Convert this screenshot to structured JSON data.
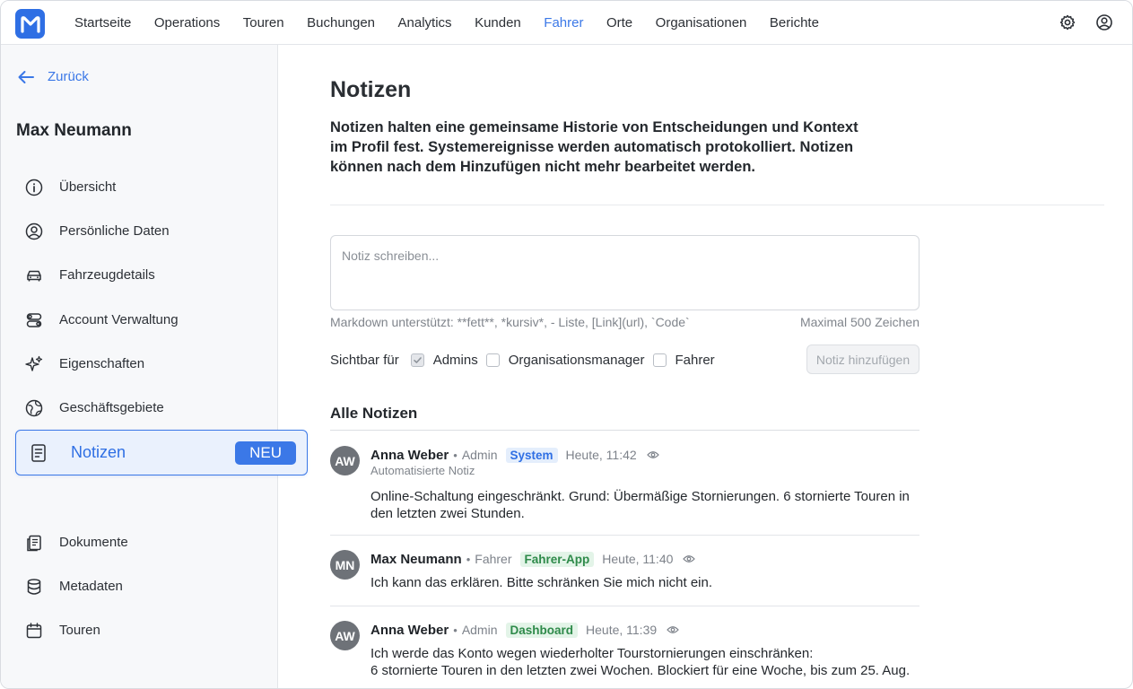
{
  "nav": {
    "items": [
      "Startseite",
      "Operations",
      "Touren",
      "Buchungen",
      "Analytics",
      "Kunden",
      "Fahrer",
      "Orte",
      "Organisationen",
      "Berichte"
    ],
    "active": "Fahrer",
    "icons": [
      "settings-gear-icon",
      "user-account-icon"
    ]
  },
  "sidebar": {
    "back_label": "Zurück",
    "driver_name": "Max Neumann",
    "items": [
      {
        "label": "Übersicht",
        "icon": "info-icon"
      },
      {
        "label": "Persönliche Daten",
        "icon": "user-circle-icon"
      },
      {
        "label": "Fahrzeugdetails",
        "icon": "car-icon"
      },
      {
        "label": "Account Verwaltung",
        "icon": "toggles-icon"
      },
      {
        "label": "Eigenschaften",
        "icon": "sparkles-icon"
      },
      {
        "label": "Geschäftsgebiete",
        "icon": "globe-icon"
      },
      {
        "label": "Notizen",
        "icon": "document-icon",
        "badge": "NEU"
      },
      {
        "label": "Dokumente",
        "icon": "documents-icon"
      },
      {
        "label": "Metadaten",
        "icon": "database-icon"
      },
      {
        "label": "Touren",
        "icon": "calendar-icon"
      }
    ],
    "active": "Notizen"
  },
  "main": {
    "title": "Notizen",
    "intro": "Notizen halten eine gemeinsame Historie von Entscheidungen und Kontext im Profil fest. Systemereignisse werden automatisch protokolliert. Notizen können nach dem Hinzufügen nicht mehr bearbeitet werden.",
    "input_placeholder": "Notiz schreiben...",
    "markdown_hint": "Markdown unterstützt: **fett**, *kursiv*, - Liste, [Link](url), `Code`",
    "max_chars": "Maximal 500 Zeichen",
    "visible_for_label": "Sichtbar für",
    "visibility": [
      {
        "label": "Admins",
        "checked": true
      },
      {
        "label": "Organisationsmanager",
        "checked": false
      },
      {
        "label": "Fahrer",
        "checked": false
      }
    ],
    "add_button": "Notiz hinzufügen",
    "all_notes_title": "Alle Notizen",
    "notes": [
      {
        "initials": "AW",
        "author": "Anna Weber",
        "role": "Admin",
        "tag": "System",
        "tag_color": "#2f6fe4",
        "time": "Heute, 11:42",
        "sub": "Automatisierte Notiz",
        "body": "Online-Schaltung eingeschränkt. Grund: Übermäßige Stornierungen. 6 stornierte Touren in den letzten zwei Stunden."
      },
      {
        "initials": "MN",
        "author": "Max Neumann",
        "role": "Fahrer",
        "tag": "Fahrer-App",
        "tag_color": "#2e8a4a",
        "time": "Heute, 11:40",
        "body": "Ich kann das erklären. Bitte schränken Sie mich nicht ein."
      },
      {
        "initials": "AW",
        "author": "Anna Weber",
        "role": "Admin",
        "tag": "Dashboard",
        "tag_color": "#2e8a4a",
        "time": "Heute, 11:39",
        "body_line1": "Ich werde das Konto wegen wiederholter Tourstornierungen einschränken:",
        "body_line2": "6 stornierte Touren in den letzten zwei Wochen. Blockiert für eine Woche, bis zum 25. Aug."
      }
    ]
  }
}
